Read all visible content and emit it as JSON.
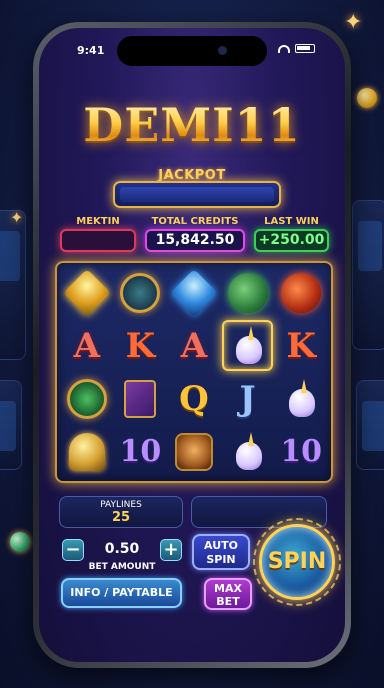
{
  "status_bar": {
    "time": "9:41"
  },
  "logo": {
    "text": "DEMI11"
  },
  "jackpot": {
    "label": "JACKPOT"
  },
  "stats": {
    "left_label": "MEKTIN",
    "mid_label": "TOTAL CREDITS",
    "mid_value": "15,842.50",
    "right_label": "LAST WIN",
    "right_value": "+250.00"
  },
  "reels": {
    "rows": [
      [
        "gold-gem-icon",
        "compass-medal-icon",
        "blue-gem-icon",
        "green-dragon-icon",
        "red-dragon-icon"
      ],
      [
        "A",
        "K",
        "A",
        "unicorn-icon",
        "K"
      ],
      [
        "green-medal-icon",
        "spellbook-icon",
        "Q",
        "J",
        "unicorn-icon"
      ],
      [
        "helmet-icon",
        "10",
        "bull-icon",
        "unicorn-icon",
        "10"
      ]
    ],
    "highlighted_cell": {
      "row": 1,
      "col": 3
    }
  },
  "controls": {
    "paylines_label": "PAYLINES",
    "paylines_value": "25",
    "bet_value": "0.50",
    "bet_label": "BET AMOUNT",
    "minus": "−",
    "plus": "+",
    "auto_spin_line1": "AUTO",
    "auto_spin_line2": "SPIN",
    "info_label": "INFO / PAYTABLE",
    "max_bet_line1": "MAX",
    "max_bet_line2": "BET",
    "spin_label": "SPIN"
  },
  "colors": {
    "gold": "#ffd35a",
    "credits_border": "#e04ae0",
    "win_green": "#7dff8a",
    "left_box_border": "#d83a5a"
  }
}
